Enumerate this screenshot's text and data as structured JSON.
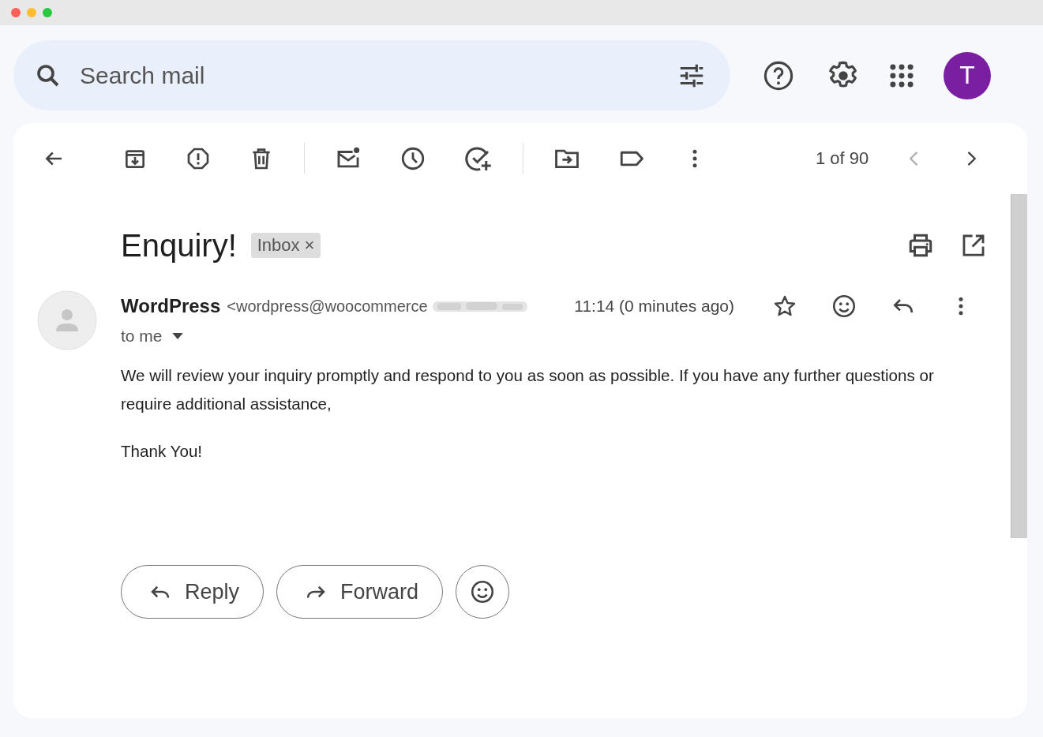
{
  "search": {
    "placeholder": "Search mail"
  },
  "account": {
    "initial": "T"
  },
  "toolbar": {
    "counter": "1 of 90",
    "prev": {
      "disabled": true
    },
    "next": {
      "disabled": false
    }
  },
  "message": {
    "subject": "Enquiry!",
    "labels": [
      {
        "text": "Inbox",
        "remove": "×"
      }
    ],
    "sender_name": "WordPress",
    "sender_email": "<wordpress@woocommerce",
    "email_redacted": true,
    "time": "11:14 (0 minutes ago)",
    "starred": false,
    "recipient": "to me",
    "body": [
      "We will review your inquiry promptly and respond to you as soon as possible. If you have any further questions or require additional assistance,",
      "Thank You!"
    ]
  },
  "actions": [
    {
      "kind": "reply",
      "label": "Reply"
    },
    {
      "kind": "forward",
      "label": "Forward"
    },
    {
      "kind": "emoji"
    }
  ]
}
